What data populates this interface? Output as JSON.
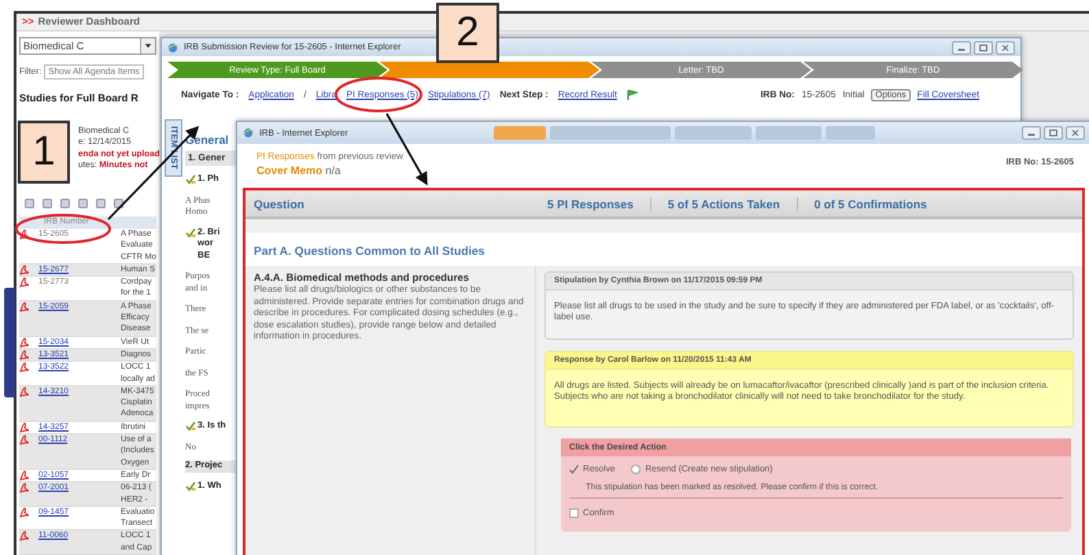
{
  "dashboard": {
    "marker": ">>",
    "title": "Reviewer Dashboard",
    "committee": "Biomedical C",
    "filter_label": "Filter:",
    "filter_value": "Show All Agenda Items",
    "heading": "Studies for Full Board R",
    "info": [
      {
        "text": "Biomedical C",
        "alert": false
      },
      {
        "text": "e: 12/14/2015",
        "alert": false
      },
      {
        "text": "enda not yet upload",
        "alert": true
      }
    ],
    "minutes": {
      "label": "utes:",
      "value": "Minutes not"
    },
    "column_header": "IRB Number",
    "rows": [
      {
        "irb": "15-2605",
        "link": false,
        "title_lines": [
          "A Phase",
          "Evaluate",
          "CFTR Mo"
        ]
      },
      {
        "irb": "15-2677",
        "link": true,
        "title_lines": [
          "Human S"
        ]
      },
      {
        "irb": "15-2773",
        "link": false,
        "title_lines": [
          "Cordpay",
          "for the 1"
        ]
      },
      {
        "irb": "15-2059",
        "link": true,
        "title_lines": [
          "A Phase",
          "Efficacy",
          "Disease"
        ]
      },
      {
        "irb": "15-2034",
        "link": true,
        "title_lines": [
          "VieR Ut"
        ]
      },
      {
        "irb": "13-3521",
        "link": true,
        "title_lines": [
          "Diagnos"
        ]
      },
      {
        "irb": "13-3522",
        "link": true,
        "title_lines": [
          "LOCC 1",
          "locally ad"
        ]
      },
      {
        "irb": "14-3210",
        "link": true,
        "title_lines": [
          "MK-3475",
          "Cisplatin",
          "Adenoca"
        ]
      },
      {
        "irb": "14-3257",
        "link": true,
        "title_lines": [
          "Ibrutini"
        ]
      },
      {
        "irb": "00-1112",
        "link": true,
        "title_lines": [
          "Use of a",
          "(Includes",
          "Oxygen"
        ]
      },
      {
        "irb": "02-1057",
        "link": true,
        "title_lines": [
          "Early Dr"
        ]
      },
      {
        "irb": "07-2001",
        "link": true,
        "title_lines": [
          "06-213 (",
          "HER2 -"
        ]
      },
      {
        "irb": "09-1457",
        "link": true,
        "title_lines": [
          "Evaluatio",
          "Transect"
        ]
      },
      {
        "irb": "11-0060",
        "link": true,
        "title_lines": [
          "LOCC 1",
          "and Cap"
        ]
      }
    ]
  },
  "review_window": {
    "title": "IRB Submission Review for 15-2605 - Internet Explorer",
    "steps": [
      {
        "label": "Review Type: Full Board",
        "kind": "complete"
      },
      {
        "kind": "current"
      },
      {
        "label": "Letter: TBD",
        "kind": "pending"
      },
      {
        "label": "Finalize: TBD",
        "kind": "pending"
      }
    ],
    "nav_label": "Navigate To :",
    "nav": [
      {
        "kind": "link",
        "text": "Application"
      },
      {
        "kind": "separator",
        "text": "/"
      },
      {
        "kind": "link",
        "text": "Libra"
      },
      {
        "kind": "link",
        "text": "PI Responses (5)"
      },
      {
        "kind": "link",
        "text": "Stipulations (7)"
      }
    ],
    "next_step_label": "Next Step :",
    "next_step_link": "Record Result",
    "irb_label": "IRB No:",
    "irb_value": "15-2605",
    "status": "Initial",
    "options_button": "Options",
    "coversheet_link": "Fill Coversheet",
    "side_tab": "ITEM LIST",
    "section": "General",
    "subsection": "1. Gener",
    "blocks": [
      {
        "kind": "item",
        "lines": [
          "1. Ph"
        ]
      },
      {
        "kind": "para",
        "lines": [
          "A Phas",
          "Homo"
        ]
      },
      {
        "kind": "item",
        "lines": [
          "2. Bri",
          "wor",
          "BE"
        ]
      },
      {
        "kind": "para",
        "lines": [
          "Purpos",
          "and in"
        ]
      },
      {
        "kind": "para",
        "lines": [
          "There"
        ]
      },
      {
        "kind": "para",
        "lines": [
          "The se"
        ]
      },
      {
        "kind": "para",
        "lines": [
          "Partic"
        ]
      },
      {
        "kind": "para",
        "lines": [
          "the FS"
        ]
      },
      {
        "kind": "para",
        "lines": [
          "Proced",
          "impres"
        ]
      },
      {
        "kind": "item",
        "lines": [
          "3. Is th"
        ]
      },
      {
        "kind": "para",
        "lines": [
          "No"
        ]
      },
      {
        "kind": "section",
        "lines": [
          "2. Projec"
        ]
      },
      {
        "kind": "item",
        "lines": [
          "1. Wh"
        ]
      }
    ]
  },
  "response_window": {
    "title": "IRB - Internet Explorer",
    "toolbar_tabs": [
      {
        "selected": true
      },
      {
        "selected": false
      },
      {
        "selected": false
      },
      {
        "selected": false
      },
      {
        "selected": false
      }
    ],
    "intro": {
      "highlight": "PI Responses",
      "text": "from previous review"
    },
    "cover_memo": {
      "label": "Cover Memo",
      "value": "n/a"
    },
    "irb_label": "IRB No:",
    "irb_value": "15-2605",
    "columns": [
      "Question",
      "5 PI Responses",
      "5 of 5 Actions Taken",
      "0 of 5 Confirmations"
    ],
    "part_heading": "Part A. Questions Common to All Studies",
    "question_title": "A.4.A. Biomedical methods and procedures",
    "question_text": "Please list all drugs/biologics or other substances to be administered. Provide separate entries for combination drugs and describe in procedures. For complicated dosing schedules (e.g., dose escalation studies), provide range below and detailed information in procedures.",
    "stipulation": {
      "header": "Stipulation by Cynthia Brown on 11/17/2015 09:59 PM",
      "text": "Please list all drugs to be used in the study and be sure to specify if they are administered per FDA label, or as 'cocktails', off-label use."
    },
    "response": {
      "header": "Response by Carol Barlow on 11/20/2015 11:43 AM",
      "text": "All drugs are listed.   Subjects will already be on lumacaftor/ivacaftor (prescribed clinically )and is part of the inclusion criteria.  Subjects who are not taking a bronchodilator clinically will not need to take bronchodilator for the study."
    },
    "action": {
      "header": "Click the Desired Action",
      "options": [
        {
          "label": "Resolve",
          "selected": true
        },
        {
          "label": "Resend (Create new stipulation)",
          "selected": false
        }
      ],
      "note": "This stipulation has been marked as resolved. Please confirm if this is correct.",
      "confirm": {
        "label": "Confirm",
        "checked": false
      }
    }
  },
  "callouts": [
    {
      "label": "1"
    },
    {
      "label": "2"
    }
  ]
}
